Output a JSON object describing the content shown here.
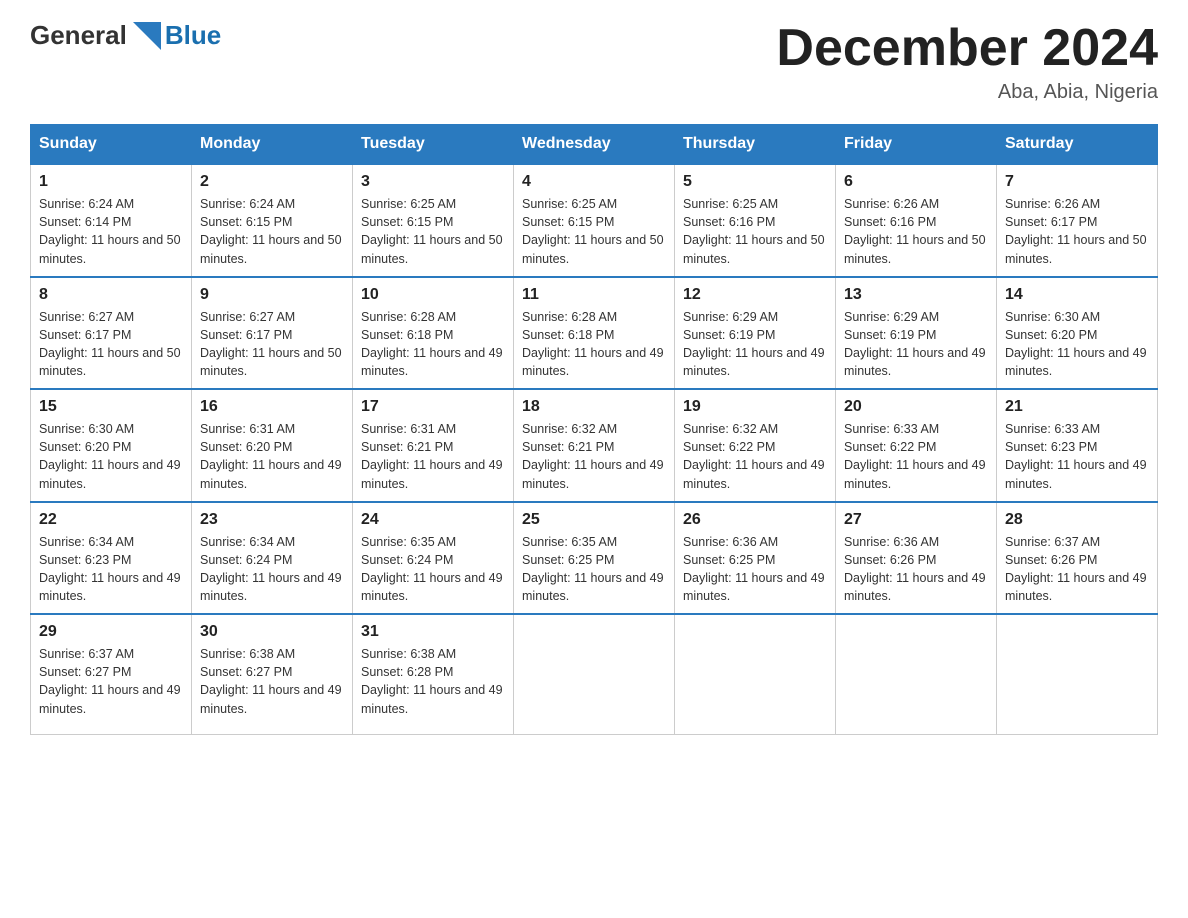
{
  "header": {
    "logo_general": "General",
    "logo_blue": "Blue",
    "month_title": "December 2024",
    "location": "Aba, Abia, Nigeria"
  },
  "days_of_week": [
    "Sunday",
    "Monday",
    "Tuesday",
    "Wednesday",
    "Thursday",
    "Friday",
    "Saturday"
  ],
  "weeks": [
    [
      {
        "day": "1",
        "sunrise": "6:24 AM",
        "sunset": "6:14 PM",
        "daylight": "11 hours and 50 minutes."
      },
      {
        "day": "2",
        "sunrise": "6:24 AM",
        "sunset": "6:15 PM",
        "daylight": "11 hours and 50 minutes."
      },
      {
        "day": "3",
        "sunrise": "6:25 AM",
        "sunset": "6:15 PM",
        "daylight": "11 hours and 50 minutes."
      },
      {
        "day": "4",
        "sunrise": "6:25 AM",
        "sunset": "6:15 PM",
        "daylight": "11 hours and 50 minutes."
      },
      {
        "day": "5",
        "sunrise": "6:25 AM",
        "sunset": "6:16 PM",
        "daylight": "11 hours and 50 minutes."
      },
      {
        "day": "6",
        "sunrise": "6:26 AM",
        "sunset": "6:16 PM",
        "daylight": "11 hours and 50 minutes."
      },
      {
        "day": "7",
        "sunrise": "6:26 AM",
        "sunset": "6:17 PM",
        "daylight": "11 hours and 50 minutes."
      }
    ],
    [
      {
        "day": "8",
        "sunrise": "6:27 AM",
        "sunset": "6:17 PM",
        "daylight": "11 hours and 50 minutes."
      },
      {
        "day": "9",
        "sunrise": "6:27 AM",
        "sunset": "6:17 PM",
        "daylight": "11 hours and 50 minutes."
      },
      {
        "day": "10",
        "sunrise": "6:28 AM",
        "sunset": "6:18 PM",
        "daylight": "11 hours and 49 minutes."
      },
      {
        "day": "11",
        "sunrise": "6:28 AM",
        "sunset": "6:18 PM",
        "daylight": "11 hours and 49 minutes."
      },
      {
        "day": "12",
        "sunrise": "6:29 AM",
        "sunset": "6:19 PM",
        "daylight": "11 hours and 49 minutes."
      },
      {
        "day": "13",
        "sunrise": "6:29 AM",
        "sunset": "6:19 PM",
        "daylight": "11 hours and 49 minutes."
      },
      {
        "day": "14",
        "sunrise": "6:30 AM",
        "sunset": "6:20 PM",
        "daylight": "11 hours and 49 minutes."
      }
    ],
    [
      {
        "day": "15",
        "sunrise": "6:30 AM",
        "sunset": "6:20 PM",
        "daylight": "11 hours and 49 minutes."
      },
      {
        "day": "16",
        "sunrise": "6:31 AM",
        "sunset": "6:20 PM",
        "daylight": "11 hours and 49 minutes."
      },
      {
        "day": "17",
        "sunrise": "6:31 AM",
        "sunset": "6:21 PM",
        "daylight": "11 hours and 49 minutes."
      },
      {
        "day": "18",
        "sunrise": "6:32 AM",
        "sunset": "6:21 PM",
        "daylight": "11 hours and 49 minutes."
      },
      {
        "day": "19",
        "sunrise": "6:32 AM",
        "sunset": "6:22 PM",
        "daylight": "11 hours and 49 minutes."
      },
      {
        "day": "20",
        "sunrise": "6:33 AM",
        "sunset": "6:22 PM",
        "daylight": "11 hours and 49 minutes."
      },
      {
        "day": "21",
        "sunrise": "6:33 AM",
        "sunset": "6:23 PM",
        "daylight": "11 hours and 49 minutes."
      }
    ],
    [
      {
        "day": "22",
        "sunrise": "6:34 AM",
        "sunset": "6:23 PM",
        "daylight": "11 hours and 49 minutes."
      },
      {
        "day": "23",
        "sunrise": "6:34 AM",
        "sunset": "6:24 PM",
        "daylight": "11 hours and 49 minutes."
      },
      {
        "day": "24",
        "sunrise": "6:35 AM",
        "sunset": "6:24 PM",
        "daylight": "11 hours and 49 minutes."
      },
      {
        "day": "25",
        "sunrise": "6:35 AM",
        "sunset": "6:25 PM",
        "daylight": "11 hours and 49 minutes."
      },
      {
        "day": "26",
        "sunrise": "6:36 AM",
        "sunset": "6:25 PM",
        "daylight": "11 hours and 49 minutes."
      },
      {
        "day": "27",
        "sunrise": "6:36 AM",
        "sunset": "6:26 PM",
        "daylight": "11 hours and 49 minutes."
      },
      {
        "day": "28",
        "sunrise": "6:37 AM",
        "sunset": "6:26 PM",
        "daylight": "11 hours and 49 minutes."
      }
    ],
    [
      {
        "day": "29",
        "sunrise": "6:37 AM",
        "sunset": "6:27 PM",
        "daylight": "11 hours and 49 minutes."
      },
      {
        "day": "30",
        "sunrise": "6:38 AM",
        "sunset": "6:27 PM",
        "daylight": "11 hours and 49 minutes."
      },
      {
        "day": "31",
        "sunrise": "6:38 AM",
        "sunset": "6:28 PM",
        "daylight": "11 hours and 49 minutes."
      },
      null,
      null,
      null,
      null
    ]
  ],
  "labels": {
    "sunrise": "Sunrise:",
    "sunset": "Sunset:",
    "daylight": "Daylight:"
  }
}
